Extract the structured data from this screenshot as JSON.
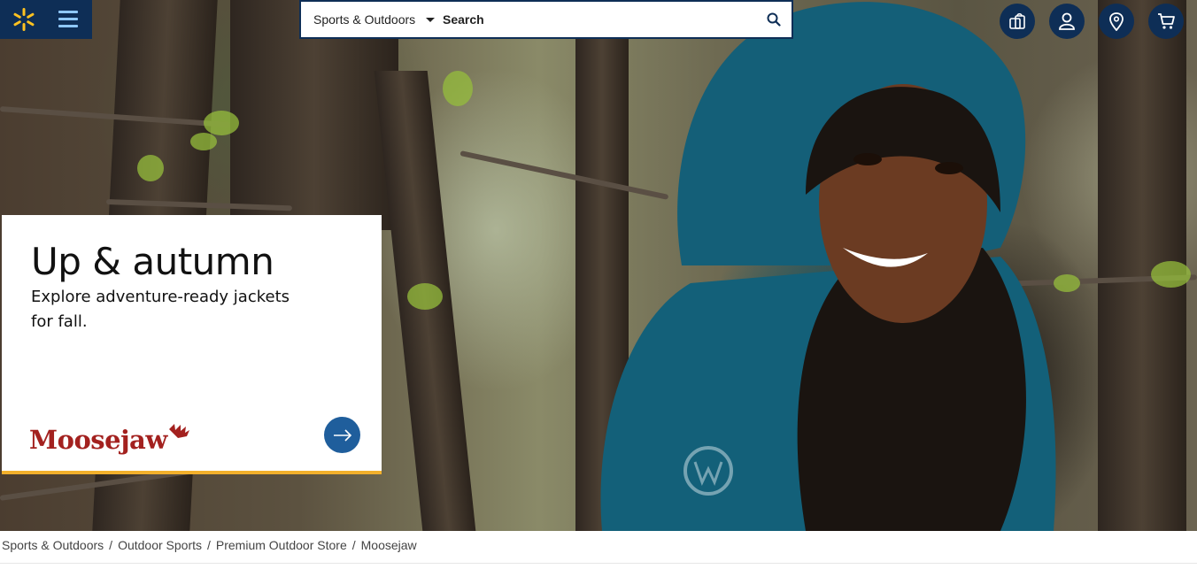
{
  "header": {
    "department_label": "Sports & Outdoors",
    "search_placeholder": "Search",
    "icons": [
      "spark-logo-icon",
      "menu-icon",
      "search-icon",
      "registry-icon",
      "account-icon",
      "location-icon",
      "cart-icon"
    ],
    "colors": {
      "nav": "#0e2e56",
      "spark": "#ffc220",
      "menu": "#8fc8ff"
    }
  },
  "promo": {
    "title": "Up & autumn",
    "subtitle": "Explore adventure-ready jackets for fall.",
    "brand_logo_text": "Moosejaw",
    "colors": {
      "accent_border": "#f2b02c",
      "arrow_button": "#1f5e9c",
      "brand": "#a3211f"
    }
  },
  "breadcrumb": {
    "items": [
      "Sports & Outdoors",
      "Outdoor Sports",
      "Premium Outdoor Store",
      "Moosejaw"
    ],
    "separator": "/"
  }
}
